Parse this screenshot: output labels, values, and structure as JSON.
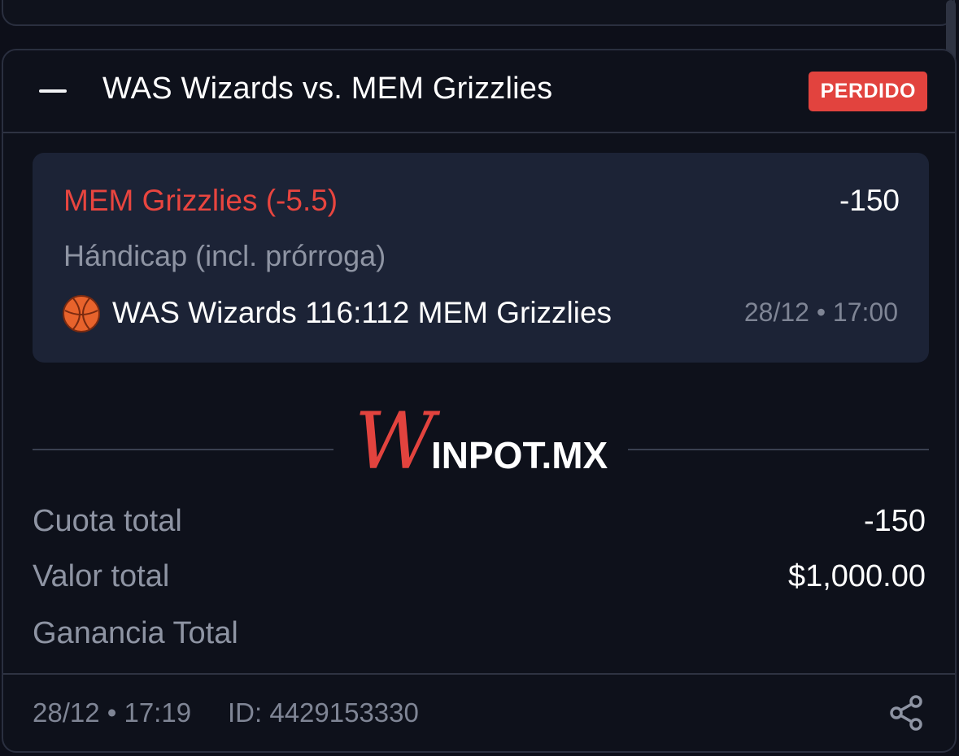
{
  "bet": {
    "event_title": "WAS Wizards vs. MEM Grizzlies",
    "status_badge": "PERDIDO",
    "selection": {
      "name": "MEM Grizzlies (-5.5)",
      "odds": "-150",
      "market": "Hándicap (incl. prórroga)",
      "sport_icon": "basketball-icon",
      "result": "WAS Wizards 116:112 MEM Grizzlies",
      "datetime": "28/12 • 17:00"
    },
    "brand": {
      "logo_initial": "W",
      "logo_rest": "INPOT.MX"
    },
    "summary": {
      "total_odds_label": "Cuota total",
      "total_odds_value": "-150",
      "total_stake_label": "Valor total",
      "total_stake_value": "$1,000.00",
      "total_win_label": "Ganancia Total",
      "total_win_value": ""
    },
    "footer": {
      "placed_datetime": "28/12 • 17:19",
      "bet_id": "ID: 4429153330",
      "share_icon": "share-icon"
    }
  },
  "colors": {
    "background": "#0d0f19",
    "lost_badge": "#e2433e",
    "selection_text": "#e8453f",
    "selection_box": "#1c2336",
    "muted_text": "#8e94a3"
  }
}
